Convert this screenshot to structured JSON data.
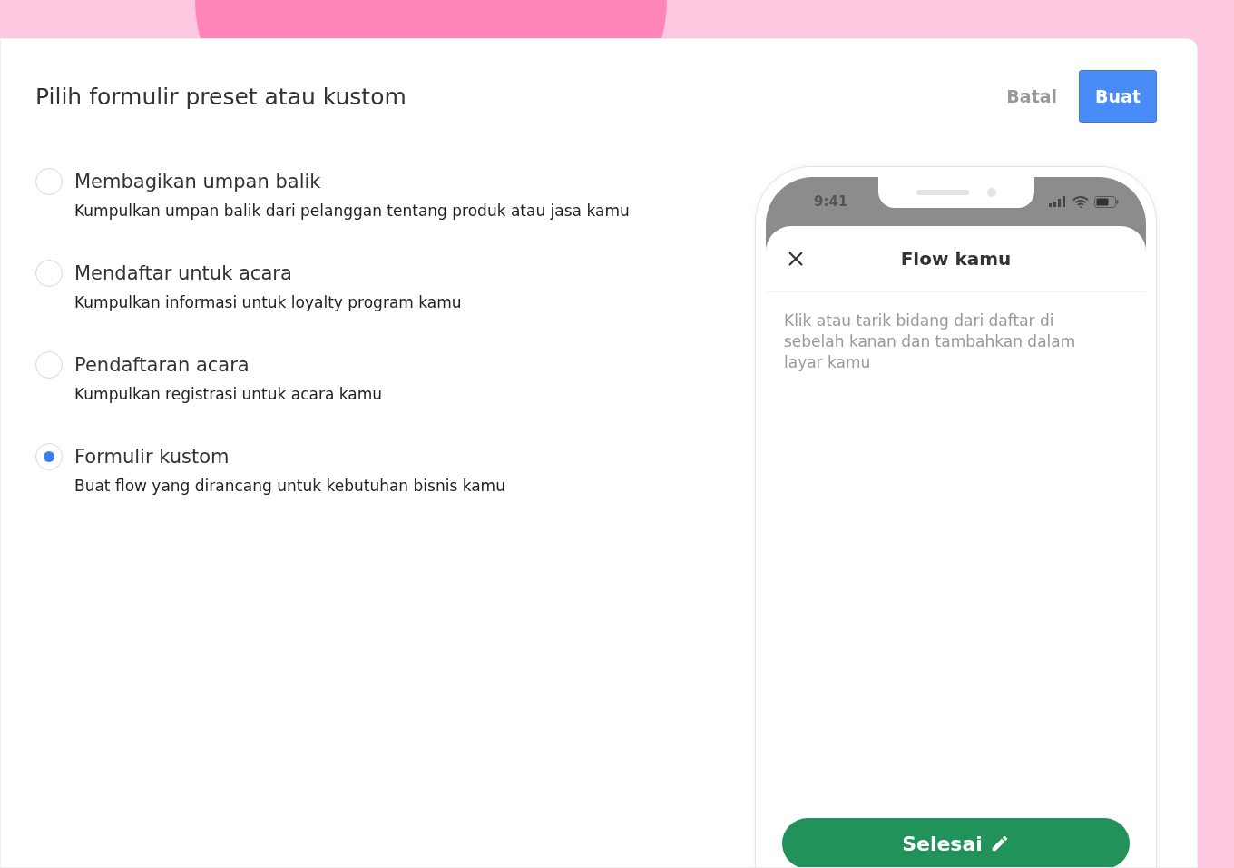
{
  "dialog": {
    "title": "Pilih formulir preset atau kustom",
    "buttons": [
      {
        "label": "Batal",
        "kind": "secondary"
      },
      {
        "label": "Buat",
        "kind": "primary"
      }
    ]
  },
  "options": [
    {
      "title": "Membagikan umpan balik",
      "description": "Kumpulkan umpan balik dari pelanggan tentang produk atau jasa kamu",
      "selected": false
    },
    {
      "title": "Mendaftar untuk acara",
      "description": "Kumpulkan informasi untuk loyalty program kamu",
      "selected": false
    },
    {
      "title": "Pendaftaran acara",
      "description": "Kumpulkan registrasi untuk acara kamu",
      "selected": false
    },
    {
      "title": "Formulir kustom",
      "description": "Buat flow yang dirancang untuk kebutuhan bisnis kamu",
      "selected": true
    }
  ],
  "preview": {
    "status_time": "9:41",
    "screen_title": "Flow kamu",
    "hint": "Klik atau tarik bidang dari daftar di sebelah kanan dan tambahkan dalam layar kamu",
    "done_button": "Selesai"
  }
}
